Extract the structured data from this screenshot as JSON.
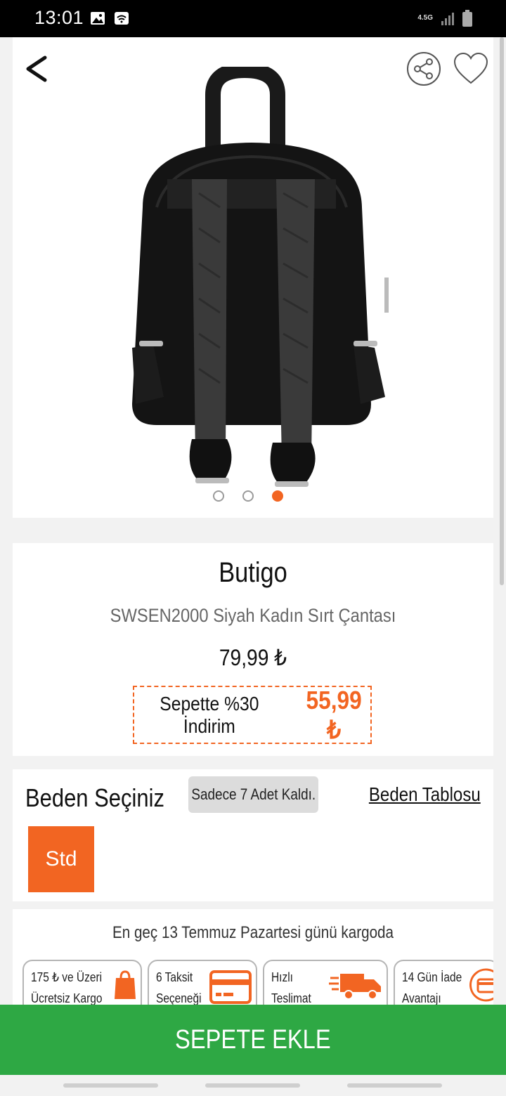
{
  "status_bar": {
    "time": "13:01",
    "network": "4.5G",
    "icons": [
      "image-icon",
      "wifi-icon",
      "signal-icon",
      "battery-icon"
    ]
  },
  "product_images": {
    "count": 3,
    "active_index": 2
  },
  "product": {
    "brand": "Butigo",
    "name": "SWSEN2000 Siyah Kadın Sırt Çantası",
    "price": "79,99 ₺",
    "promo_text": "Sepette %30 İndirim",
    "promo_price": "55,99 ₺"
  },
  "size_section": {
    "title": "Beden Seçiniz",
    "stock_badge": "Sadece 7 Adet Kaldı.",
    "size_table_link": "Beden Tablosu",
    "sizes": [
      "Std"
    ]
  },
  "shipping": {
    "text": "En geç 13 Temmuz Pazartesi günü kargoda",
    "features": [
      {
        "line1": "175 ₺ ve Üzeri",
        "line2": "Ücretsiz Kargo",
        "icon": "shopping-bag-icon"
      },
      {
        "line1": "6 Taksit",
        "line2": "Seçeneği",
        "icon": "credit-card-icon"
      },
      {
        "line1": "Hızlı",
        "line2": "Teslimat",
        "icon": "delivery-truck-icon"
      },
      {
        "line1": "14 Gün İade",
        "line2": "Avantajı",
        "icon": "return-icon"
      }
    ]
  },
  "cta": {
    "add_to_cart": "SEPETE EKLE"
  },
  "colors": {
    "accent": "#f26522",
    "cta": "#2ea844"
  }
}
